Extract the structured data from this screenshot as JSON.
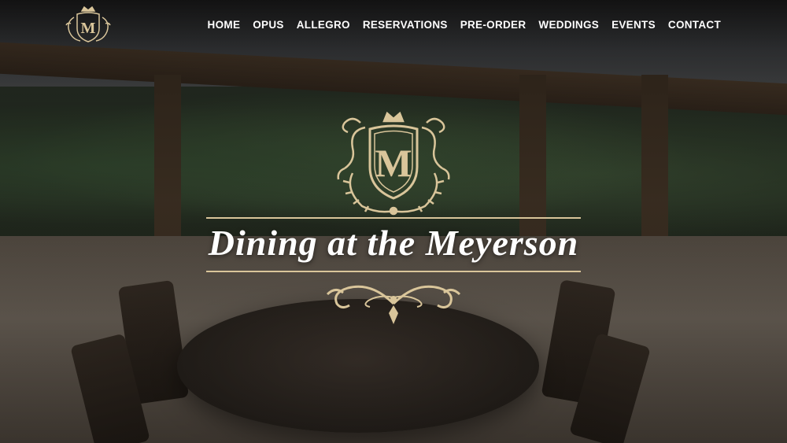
{
  "brand": {
    "logo_monogram": "M"
  },
  "nav": {
    "items": [
      {
        "label": "HOME"
      },
      {
        "label": "OPUS"
      },
      {
        "label": "ALLEGRO"
      },
      {
        "label": "RESERVATIONS"
      },
      {
        "label": "PRE-ORDER"
      },
      {
        "label": "WEDDINGS"
      },
      {
        "label": "EVENTS"
      },
      {
        "label": "CONTACT"
      }
    ]
  },
  "hero": {
    "crest_monogram": "M",
    "title": "Dining at the Meyerson"
  },
  "colors": {
    "gold": "#d9c59a",
    "nav_text": "#ffffff",
    "title_text": "#ffffff"
  },
  "icons": {
    "logo": "crest-crown-icon",
    "crest": "crest-crown-icon",
    "flourish": "ornament-flourish-icon"
  }
}
